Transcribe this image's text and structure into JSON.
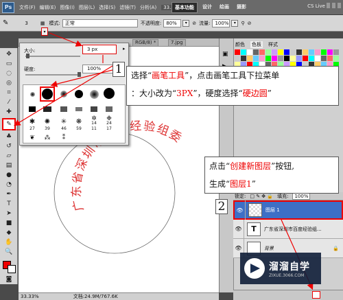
{
  "menubar": {
    "logo": "Ps",
    "items": [
      "文件(F)",
      "编辑(E)",
      "图像(I)",
      "图层(L)",
      "选择(S)",
      "滤镜(T)",
      "分析(A)"
    ],
    "zoom": "33.3",
    "workspaces": [
      "基本功能",
      "设计",
      "绘画",
      "摄影"
    ],
    "cs_live": "CS Live"
  },
  "options": {
    "brush_size": "3",
    "mode_label": "模式:",
    "mode_value": "正常",
    "opacity_label": "不透明度:",
    "opacity_value": "80%",
    "flow_label": "流量:",
    "flow_value": "100%"
  },
  "brush_popup": {
    "size_label": "大小:",
    "size_value": "3 px",
    "hardness_label": "硬度:",
    "hardness_value": "100%",
    "brush_numbers": [
      "27",
      "39",
      "46",
      "59",
      "11",
      "17",
      "14",
      "24"
    ]
  },
  "doc": {
    "tab1": "RGB/8) *",
    "tab2": "7.jpg",
    "zoom_status": "33.33%",
    "doc_size": "文档:24.9M/767.6K"
  },
  "stamp": {
    "text": "广东省深圳市百度经验组委员会",
    "color": "#dd3333"
  },
  "panels": {
    "tabs": [
      "颜色",
      "色板",
      "样式"
    ]
  },
  "layers": {
    "lock_label": "锁定:",
    "fill_label": "填充:",
    "fill_value": "100%",
    "rows": [
      {
        "name": "图层 1",
        "selected": true
      },
      {
        "name": "广东省深圳市百度经验组..."
      },
      {
        "name": "背景"
      }
    ]
  },
  "annotations": {
    "callout1_num": "1",
    "callout1_line1_a": "选择“",
    "callout1_line1_hl1": "画笔工具",
    "callout1_line1_b": "”，点击画笔工具下拉菜单",
    "callout1_line2_a": "：大小改为“",
    "callout1_line2_hl1": "3PX",
    "callout1_line2_b": "”，硬度选择“",
    "callout1_line2_hl2": "硬边圆",
    "callout1_line2_c": "”",
    "callout2_num": "2",
    "callout2_line1_a": "点击“",
    "callout2_line1_hl": "创建新图层",
    "callout2_line1_b": "”按钮,",
    "callout2_line2_a": "生成“",
    "callout2_line2_hl": "图层1",
    "callout2_line2_b": "”"
  },
  "watermark": {
    "title": "溜溜自学",
    "subtitle": "ZIXUE.3066.COM"
  }
}
